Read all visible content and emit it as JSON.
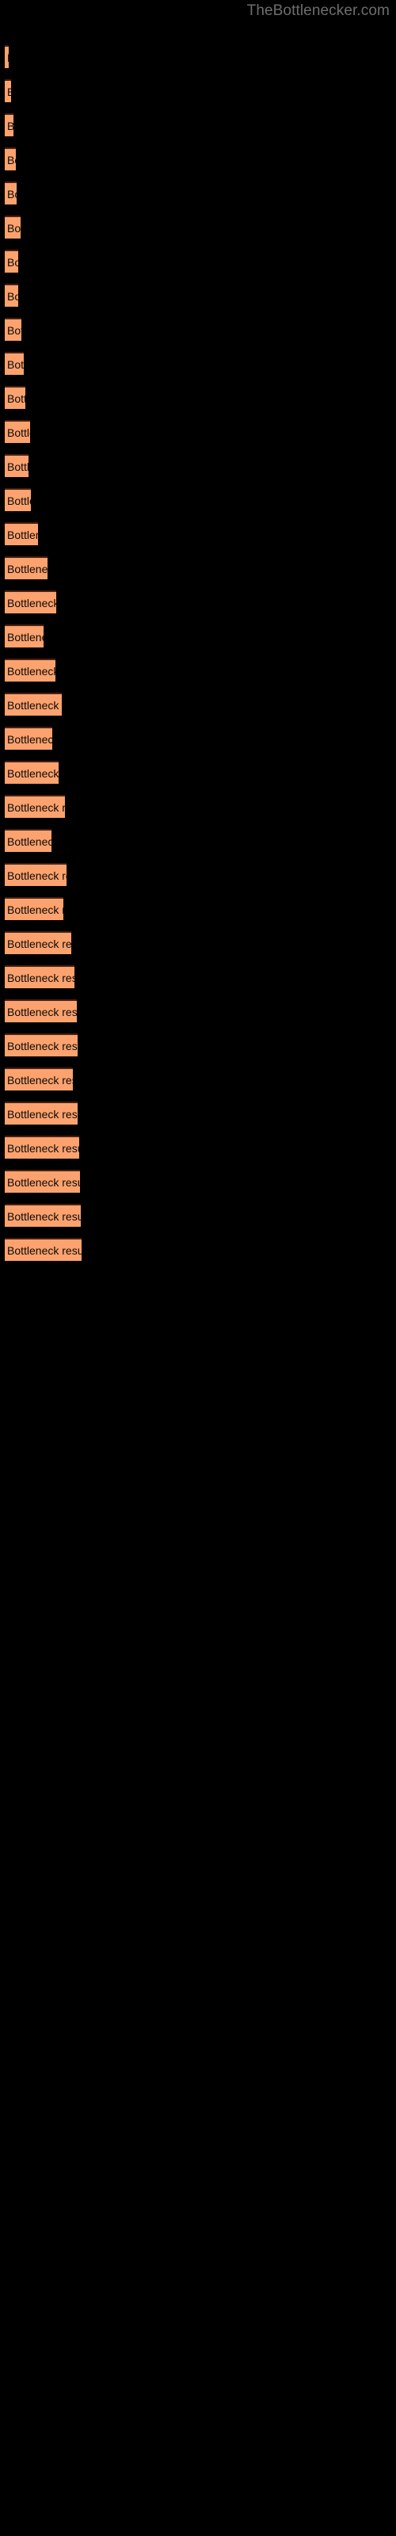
{
  "watermark": "TheBottlenecker.com",
  "colors": {
    "background": "#000000",
    "bar_fill": "#fca26e",
    "bar_border": "#4a1f10",
    "label_text": "#0a0a0a",
    "watermark_text": "#6d6d6d"
  },
  "chart_data": {
    "type": "bar",
    "orientation": "horizontal",
    "title": "",
    "subtitle": "",
    "xlabel": "",
    "ylabel": "",
    "grid": false,
    "legend": null,
    "axis_labels_visible": false,
    "tick_labels_visible": false,
    "bar_label_text": "Bottleneck result",
    "xlim": [
      0,
      500
    ],
    "categories": [
      "bar-1",
      "bar-2",
      "bar-3",
      "bar-4",
      "bar-5",
      "bar-6",
      "bar-7",
      "bar-8",
      "bar-9",
      "bar-10",
      "bar-11",
      "bar-12",
      "bar-13",
      "bar-14",
      "bar-15",
      "bar-16",
      "bar-17",
      "bar-18",
      "bar-19",
      "bar-20",
      "bar-21",
      "bar-22",
      "bar-23",
      "bar-24",
      "bar-25",
      "bar-26",
      "bar-27",
      "bar-28",
      "bar-29",
      "bar-30",
      "bar-31",
      "bar-32",
      "bar-33",
      "bar-34",
      "bar-35",
      "bar-36"
    ],
    "values": [
      5,
      8,
      11,
      14,
      15,
      20,
      17,
      17,
      21,
      24,
      26,
      32,
      30,
      33,
      42,
      54,
      65,
      49,
      64,
      72,
      60,
      68,
      76,
      59,
      78,
      74,
      84,
      88,
      91,
      92,
      86,
      92,
      94,
      95,
      96,
      97
    ],
    "bars": [
      {
        "index": 1,
        "label": "Bottleneck result",
        "y": 57,
        "width": 5,
        "visible_text": ""
      },
      {
        "index": 2,
        "label": "Bottleneck result",
        "y": 100,
        "width": 8,
        "visible_text": "B"
      },
      {
        "index": 3,
        "label": "Bottleneck result",
        "y": 143,
        "width": 11,
        "visible_text": "B"
      },
      {
        "index": 4,
        "label": "Bottleneck result",
        "y": 186,
        "width": 14,
        "visible_text": "B"
      },
      {
        "index": 5,
        "label": "Bottleneck result",
        "y": 229,
        "width": 15,
        "visible_text": "B"
      },
      {
        "index": 6,
        "label": "Bottleneck result",
        "y": 272,
        "width": 20,
        "visible_text": "Bo"
      },
      {
        "index": 7,
        "label": "Bottleneck result",
        "y": 315,
        "width": 17,
        "visible_text": "B"
      },
      {
        "index": 8,
        "label": "Bottleneck result",
        "y": 358,
        "width": 17,
        "visible_text": "B"
      },
      {
        "index": 9,
        "label": "Bottleneck result",
        "y": 401,
        "width": 21,
        "visible_text": "Bo"
      },
      {
        "index": 10,
        "label": "Bottleneck result",
        "y": 444,
        "width": 24,
        "visible_text": "Bo"
      },
      {
        "index": 11,
        "label": "Bottleneck result",
        "y": 487,
        "width": 26,
        "visible_text": "Bot"
      },
      {
        "index": 12,
        "label": "Bottleneck result",
        "y": 530,
        "width": 32,
        "visible_text": "Bottl"
      },
      {
        "index": 13,
        "label": "Bottleneck result",
        "y": 573,
        "width": 30,
        "visible_text": "Bott"
      },
      {
        "index": 14,
        "label": "Bottleneck result",
        "y": 616,
        "width": 33,
        "visible_text": "Bottl"
      },
      {
        "index": 15,
        "label": "Bottleneck result",
        "y": 659,
        "width": 42,
        "visible_text": "Bottlene"
      },
      {
        "index": 16,
        "label": "Bottleneck result",
        "y": 702,
        "width": 54,
        "visible_text": "Bottleneck res"
      },
      {
        "index": 17,
        "label": "Bottleneck result",
        "y": 745,
        "width": 65,
        "visible_text": "Bottleneck"
      },
      {
        "index": 18,
        "label": "Bottleneck result",
        "y": 788,
        "width": 49,
        "visible_text": "Bottleneck resu"
      },
      {
        "index": 19,
        "label": "Bottleneck result",
        "y": 831,
        "width": 64,
        "visible_text": "Bottleneck result"
      },
      {
        "index": 20,
        "label": "Bottleneck result",
        "y": 874,
        "width": 72,
        "visible_text": "Bottleneck resu"
      },
      {
        "index": 21,
        "label": "Bottleneck result",
        "y": 917,
        "width": 60,
        "visible_text": "Bottleneck result"
      },
      {
        "index": 22,
        "label": "Bottleneck result",
        "y": 960,
        "width": 68,
        "visible_text": "Bottleneck re"
      },
      {
        "index": 23,
        "label": "Bottleneck result",
        "y": 1003,
        "width": 76,
        "visible_text": "Bottleneck result"
      },
      {
        "index": 24,
        "label": "Bottleneck result",
        "y": 1046,
        "width": 59,
        "visible_text": "Bottleneck resul"
      },
      {
        "index": 25,
        "label": "Bottleneck result",
        "y": 1089,
        "width": 78,
        "visible_text": "Bottleneck result"
      },
      {
        "index": 26,
        "label": "Bottleneck result",
        "y": 1132,
        "width": 74,
        "visible_text": "Bottleneck result"
      },
      {
        "index": 27,
        "label": "Bottleneck result",
        "y": 1175,
        "width": 84,
        "visible_text": "Bottleneck result"
      },
      {
        "index": 28,
        "label": "Bottleneck result",
        "y": 1218,
        "width": 88,
        "visible_text": "Bottleneck result"
      },
      {
        "index": 29,
        "label": "Bottleneck result",
        "y": 1261,
        "width": 91,
        "visible_text": "Bottleneck result"
      },
      {
        "index": 30,
        "label": "Bottleneck result",
        "y": 1304,
        "width": 92,
        "visible_text": "Bottleneck result"
      },
      {
        "index": 31,
        "label": "Bottleneck result",
        "y": 1347,
        "width": 86,
        "visible_text": "Bottleneck result"
      },
      {
        "index": 32,
        "label": "Bottleneck result",
        "y": 1390,
        "width": 92,
        "visible_text": "Bottleneck result"
      },
      {
        "index": 33,
        "label": "Bottleneck result",
        "y": 1433,
        "width": 94,
        "visible_text": "Bottleneck result"
      },
      {
        "index": 34,
        "label": "Bottleneck result",
        "y": 1476,
        "width": 95,
        "visible_text": "Bottleneck result"
      },
      {
        "index": 35,
        "label": "Bottleneck result",
        "y": 1519,
        "width": 96,
        "visible_text": "Bottleneck result"
      },
      {
        "index": 36,
        "label": "Bottleneck result",
        "y": 1562,
        "width": 97,
        "visible_text": "Bottleneck result"
      }
    ]
  }
}
